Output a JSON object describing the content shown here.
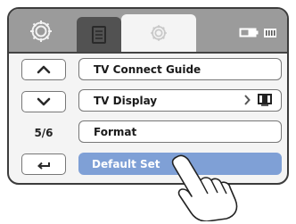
{
  "tabs": [
    {
      "icon": "settings-gear-icon"
    },
    {
      "icon": "document-icon"
    },
    {
      "icon": "settings-gear-icon",
      "active": true
    }
  ],
  "status": {
    "battery_icon": "battery-icon",
    "card_icon": "memory-card-icon"
  },
  "controls": {
    "page_indicator": "5/6"
  },
  "menu": {
    "items": [
      {
        "label": "TV Connect Guide"
      },
      {
        "label": "TV Display",
        "value_icon": "tv-display-icon"
      },
      {
        "label": "Format"
      },
      {
        "label": "Default Set",
        "selected": true
      }
    ]
  },
  "colors": {
    "selected": "#7fa0d6",
    "topbar": "#9b9b9b",
    "active_tab": "#525252"
  }
}
